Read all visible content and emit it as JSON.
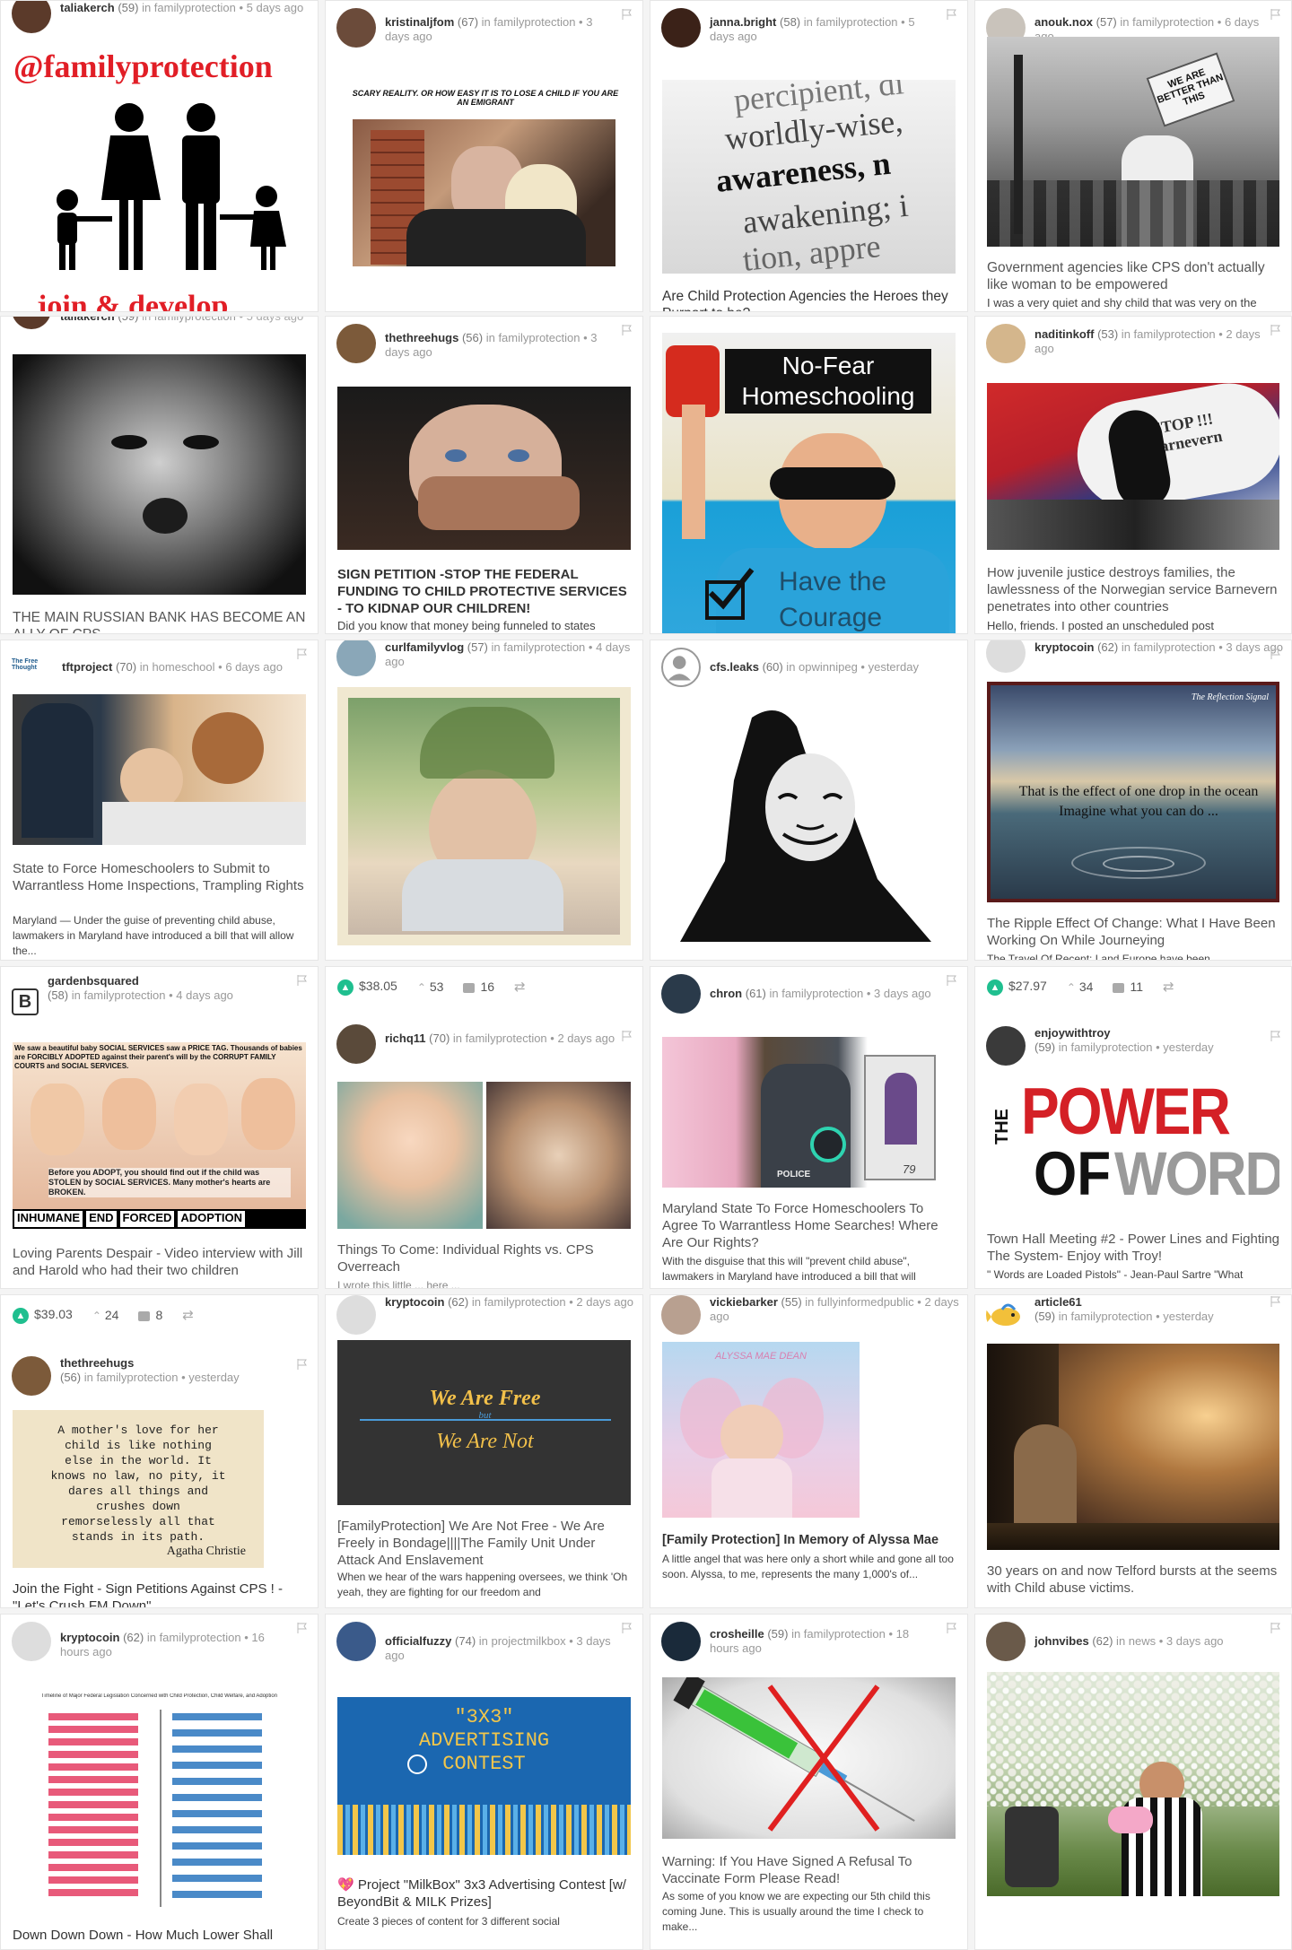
{
  "cards": {
    "c1": {
      "author": "taliakerch",
      "rep": "(59)",
      "cat": "familyprotection",
      "time": "5 days ago",
      "img_text": "@familyprotection",
      "img_text2": "join & develop"
    },
    "c2": {
      "author": "kristinaljfom",
      "rep": "(67)",
      "cat": "familyprotection",
      "time": "3 days ago",
      "img_text": "SCARY REALITY. OR HOW EASY IT IS TO LOSE A CHILD IF YOU ARE AN EMIGRANT"
    },
    "c3": {
      "author": "janna.bright",
      "rep": "(58)",
      "cat": "familyprotection",
      "time": "5 days ago",
      "title": "Are Child Protection Agencies the Heroes they Purport to be?",
      "img_lines": [
        "percipient, di",
        "worldly-wise,",
        "awareness,  n",
        "awakening; i",
        "tion,  appre"
      ]
    },
    "c4": {
      "author": "anouk.nox",
      "rep": "(57)",
      "cat": "familyprotection",
      "time": "6 days ago",
      "title": "Government agencies like CPS don't actually like woman to be empowered",
      "excerpt": "I was a very quiet and shy child that was very on the",
      "sign": "WE ARE BETTER THAN THIS"
    },
    "c5": {
      "author": "taliakerch",
      "rep": "(59)",
      "cat": "familyprotection",
      "time": "5 days ago",
      "title": "THE MAIN RUSSIAN BANK HAS BECOME AN ALLY OF CPS"
    },
    "c6": {
      "author": "thethreehugs",
      "rep": "(56)",
      "cat": "familyprotection",
      "time": "3 days ago",
      "title": "SIGN PETITION -STOP THE FEDERAL FUNDING TO CHILD PROTECTIVE SERVICES - TO KIDNAP OUR CHILDREN!",
      "excerpt": "Did you know that money being funneled to states"
    },
    "c7": {
      "img_text1": "No-Fear",
      "img_text2": "Homeschooling",
      "img_text3": "Have the",
      "img_text4": "Courage"
    },
    "c8": {
      "author": "naditinkoff",
      "rep": "(53)",
      "cat": "familyprotection",
      "time": "2 days ago",
      "title": "How juvenile justice destroys families, the lawlessness of the Norwegian service Barnevern penetrates into other countries",
      "excerpt": "Hello, friends. I posted an unscheduled post",
      "img_text": "STOP !!! Barnevern"
    },
    "c9": {
      "author": "tftproject",
      "rep": "(70)",
      "cat": "homeschool",
      "time": "6 days ago",
      "title": "State to Force Homeschoolers to Submit to Warrantless Home Inspections, Trampling Rights",
      "excerpt": "Maryland — Under the guise of preventing child abuse, lawmakers in Maryland have introduced a bill that will allow the..."
    },
    "c10": {
      "author": "curlfamilyvlog",
      "rep": "(57)",
      "cat": "familyprotection",
      "time": "4 days ago"
    },
    "c11": {
      "author": "cfs.leaks",
      "rep": "(60)",
      "cat": "opwinnipeg",
      "time": "yesterday"
    },
    "c12": {
      "author": "kryptocoin",
      "rep": "(62)",
      "cat": "familyprotection",
      "time": "3 days ago",
      "title": "The Ripple Effect Of Change: What I Have Been Working On While Journeying",
      "excerpt": "The Travel Of Recent: Land Europe have been",
      "img_text1": "The Reflection Signal",
      "img_text2": "That is the effect of one drop in the ocean",
      "img_text3": "Imagine what you can do ..."
    },
    "c13": {
      "author": "gardenbsquared",
      "rep": "(58)",
      "cat": "familyprotection",
      "time": "4 days ago",
      "title": "Loving Parents Despair - Video interview with Jill and Harold who had their two children",
      "img_top": "We saw a beautiful baby SOCIAL SERVICES saw a PRICE TAG. Thousands of babies are FORCIBLY ADOPTED against their parent's will by the CORRUPT FAMILY COURTS and SOCIAL SERVICES.",
      "img_mid": "Before you ADOPT, you should find out if the child was STOLEN by SOCIAL SERVICES. Many mother's hearts are BROKEN.",
      "img_bottom": [
        "INHUMANE",
        "END",
        "FORCED",
        "ADOPTION"
      ]
    },
    "c14": {
      "payout": "$38.05",
      "votes": "53",
      "comments": "16",
      "author": "richq11",
      "rep": "(70)",
      "cat": "familyprotection",
      "time": "2 days ago",
      "title": "Things To Come: Individual Rights vs. CPS Overreach",
      "excerpt": "I wrote this little ... here ..."
    },
    "c15": {
      "author": "chron",
      "rep": "(61)",
      "cat": "familyprotection",
      "time": "3 days ago",
      "title": "Maryland State To Force Homeschoolers To Agree To Warrantless Home Searches! Where Are Our Rights?",
      "excerpt": "With the disguise that this will \"prevent child abuse\", lawmakers in Maryland have introduced a bill that will",
      "img_text": "POLICE",
      "img_num": "79"
    },
    "c16": {
      "payout": "$27.97",
      "votes": "34",
      "comments": "11",
      "author": "enjoywithtroy",
      "rep": "(59)",
      "cat": "familyprotection",
      "time": "yesterday",
      "title": "Town Hall Meeting #2 - Power Lines and Fighting The System- Enjoy with Troy!",
      "excerpt": "\" Words are Loaded Pistols\" - Jean-Paul Sartre \"What",
      "img_the": "THE",
      "img_power": "POWER",
      "img_of": "OF",
      "img_words": "WORDS"
    },
    "c17": {
      "payout": "$39.03",
      "votes": "24",
      "comments": "8",
      "author": "thethreehugs",
      "rep": "(56)",
      "cat": "familyprotection",
      "time": "yesterday",
      "title": "Join the Fight - Sign Petitions Against CPS ! - \"Let's Crush FM Down\"",
      "quote": "A mother's love for her child is like nothing else in the world. It knows no law, no pity, it dares all things and crushes down remorselessly all that stands in its path.",
      "quote_author": "Agatha Christie"
    },
    "c18": {
      "author": "kryptocoin",
      "rep": "(62)",
      "cat": "familyprotection",
      "time": "2 days ago",
      "title": "[FamilyProtection] We Are Not Free - We Are Freely in Bondage||||The Family Unit Under Attack And Enslavement",
      "excerpt": "When we hear of the wars happening oversees, we think 'Oh yeah, they are fighting for our freedom and",
      "img_line1": "We Are Free",
      "img_but": "but",
      "img_line2": "We Are Not"
    },
    "c19": {
      "author": "vickiebarker",
      "rep": "(55)",
      "cat": "fullyinformedpublic",
      "time": "2 days ago",
      "title": "[Family Protection] In Memory of Alyssa Mae",
      "excerpt": "A little angel that was here only a short while and gone all too soon. Alyssa, to me, represents the many 1,000's of...",
      "img_text": "ALYSSA MAE DEAN"
    },
    "c20": {
      "author": "article61",
      "rep": "(59)",
      "cat": "familyprotection",
      "time": "yesterday",
      "title": "30 years on and now Telford bursts at the seems with Child abuse victims."
    },
    "c21": {
      "author": "kryptocoin",
      "rep": "(62)",
      "cat": "familyprotection",
      "time": "16 hours ago",
      "title": "Down Down Down - How Much Lower Shall",
      "img_title": "Timeline of Major Federal Legislation Concerned with Child Protection, Child Welfare, and Adoption"
    },
    "c22": {
      "author": "officialfuzzy",
      "rep": "(74)",
      "cat": "projectmilkbox",
      "time": "3 days ago",
      "title": "💖 Project \"MilkBox\" 3x3 Advertising Contest [w/ BeyondBit & MILK Prizes]",
      "excerpt": "Create 3 pieces of content for 3 different social",
      "img_3x3": "\"3X3\"",
      "img_adv": "ADVERTISING",
      "img_contest": "CONTEST"
    },
    "c23": {
      "author": "crosheille",
      "rep": "(59)",
      "cat": "familyprotection",
      "time": "18 hours ago",
      "title": "Warning: If You Have Signed A Refusal To Vaccinate Form Please Read!",
      "excerpt": "As some of you know we are expecting our 5th child this coming June. This is usually around the time I check to make..."
    },
    "c24": {
      "author": "johnvibes",
      "rep": "(62)",
      "cat": "news",
      "time": "3 days ago"
    }
  },
  "colors": {
    "upvote": "#1fbf8f",
    "power_red": "#d42026"
  }
}
